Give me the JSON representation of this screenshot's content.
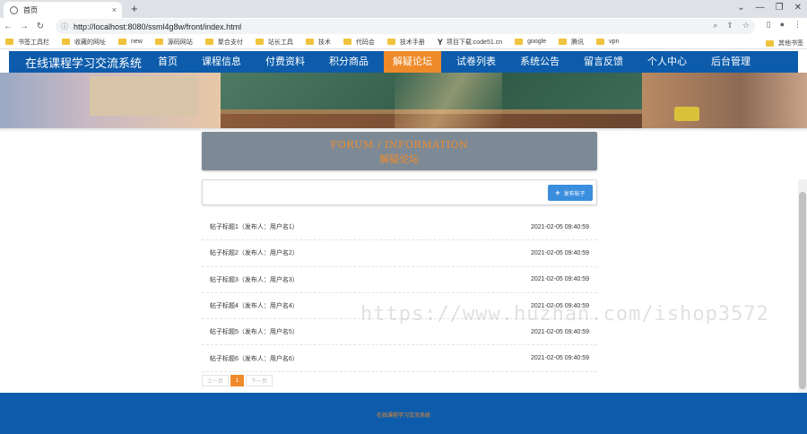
{
  "browser": {
    "tab_title": "首页",
    "tab_close": "×",
    "new_tab": "+",
    "window_controls": [
      "⌄",
      "—",
      "❐",
      "✕"
    ],
    "url": "http://localhost:8080/ssml4g8w/front/index.html",
    "bookmarks": [
      "书签工具栏",
      "收藏的网址",
      "new",
      "源码网站",
      "聚合支付",
      "站长工具",
      "技术",
      "代码会",
      "技术手册",
      "项目下载:code51.cn",
      "google",
      "腾讯",
      "vpn"
    ],
    "bookmark_right": "其他书签"
  },
  "site": {
    "title": "在线课程学习交流系统",
    "nav": [
      "首页",
      "课程信息",
      "付费资料",
      "积分商品",
      "解疑论坛",
      "试卷列表",
      "系统公告",
      "留言反馈",
      "个人中心",
      "后台管理"
    ],
    "active_nav_index": 4,
    "accent_color": "#ef8a2b",
    "brand_color": "#0d5cab"
  },
  "forum": {
    "title_en": "FORUM / INFORMATION",
    "title_cn": "解疑论坛",
    "post_button": "发布帖子",
    "posts": [
      {
        "title": "帖子标题1（发布人：用户名1）",
        "time": "2021-02-05 09:40:59"
      },
      {
        "title": "帖子标题2（发布人：用户名2）",
        "time": "2021-02-05 09:40:59"
      },
      {
        "title": "帖子标题3（发布人：用户名3）",
        "time": "2021-02-05 09:40:59"
      },
      {
        "title": "帖子标题4（发布人：用户名4）",
        "time": "2021-02-05 09:40:59"
      },
      {
        "title": "帖子标题5（发布人：用户名5）",
        "time": "2021-02-05 09:40:59"
      },
      {
        "title": "帖子标题6（发布人：用户名6）",
        "time": "2021-02-05 09:40:59"
      }
    ],
    "pagination": {
      "prev": "上一页",
      "current": "1",
      "next": "下一页"
    }
  },
  "watermark": "https://www.huzhan.com/ishop3572",
  "footer": {
    "text": "在线课程学习交流系统"
  }
}
